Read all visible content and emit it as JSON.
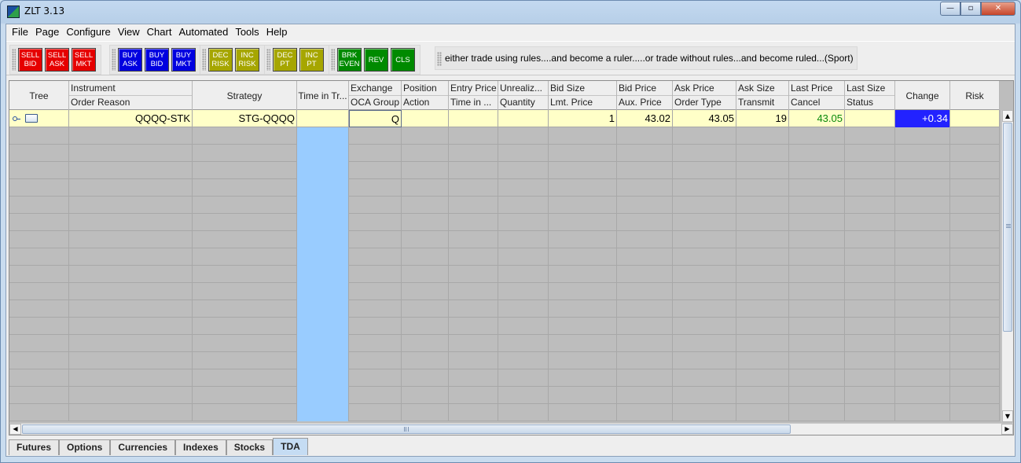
{
  "window": {
    "title": "ZLT 3.13",
    "controls": {
      "minimize": "—",
      "restore": "▫",
      "close": "✕"
    }
  },
  "menu": [
    "File",
    "Page",
    "Configure",
    "View",
    "Chart",
    "Automated",
    "Tools",
    "Help"
  ],
  "toolbar": {
    "groups": [
      [
        {
          "l1": "SELL",
          "l2": "BID",
          "color": "#e60000"
        },
        {
          "l1": "SELL",
          "l2": "ASK",
          "color": "#e60000"
        },
        {
          "l1": "SELL",
          "l2": "MKT",
          "color": "#e60000"
        }
      ],
      [
        {
          "l1": "BUY",
          "l2": "ASK",
          "color": "#0000e0"
        },
        {
          "l1": "BUY",
          "l2": "BID",
          "color": "#0000e0"
        },
        {
          "l1": "BUY",
          "l2": "MKT",
          "color": "#0000e0"
        }
      ],
      [
        {
          "l1": "DEC",
          "l2": "RISK",
          "color": "#a6a600"
        },
        {
          "l1": "INC",
          "l2": "RISK",
          "color": "#a6a600"
        }
      ],
      [
        {
          "l1": "DEC",
          "l2": "PT",
          "color": "#a6a600"
        },
        {
          "l1": "INC",
          "l2": "PT",
          "color": "#a6a600"
        }
      ],
      [
        {
          "l1": "BRK",
          "l2": "EVEN",
          "color": "#008a00"
        },
        {
          "l1": "REV",
          "l2": "",
          "color": "#008a00"
        },
        {
          "l1": "CLS",
          "l2": "",
          "color": "#008a00"
        }
      ]
    ],
    "quote": "either trade using rules....and become a ruler.....or trade without rules...and become ruled...(Sport)"
  },
  "table": {
    "headers": {
      "tree": "Tree",
      "instrument": "Instrument",
      "order_reason": "Order Reason",
      "strategy": "Strategy",
      "time_in_trade": "Time in Tr...",
      "exchange": "Exchange",
      "oca_group": "OCA Group",
      "position": "Position",
      "action": "Action",
      "entry_price": "Entry Price",
      "time_in_force": "Time in ...",
      "unrealized": "Unrealiz...",
      "quantity": "Quantity",
      "bid_size": "Bid Size",
      "lmt_price": "Lmt. Price",
      "bid_price": "Bid Price",
      "aux_price": "Aux. Price",
      "ask_price": "Ask Price",
      "order_type": "Order Type",
      "ask_size": "Ask Size",
      "transmit": "Transmit",
      "last_price": "Last Price",
      "cancel": "Cancel",
      "last_size": "Last Size",
      "status": "Status",
      "change": "Change",
      "risk": "Risk"
    },
    "row": {
      "instrument": "QQQQ-STK",
      "strategy": "STG-QQQQ",
      "time_in_trade": "",
      "exchange": "Q",
      "position": "",
      "entry_price": "",
      "unrealized": "",
      "bid_size": "1",
      "bid_price": "43.02",
      "ask_price": "43.05",
      "ask_size": "19",
      "last_price": "43.05",
      "last_size": "",
      "change": "+0.34",
      "risk": ""
    },
    "empty_rows": 17
  },
  "tabs": [
    "Futures",
    "Options",
    "Currencies",
    "Indexes",
    "Stocks",
    "TDA"
  ],
  "active_tab": "TDA",
  "scroll": {
    "up": "▲",
    "down": "▼",
    "left": "◀",
    "right": "▶"
  }
}
